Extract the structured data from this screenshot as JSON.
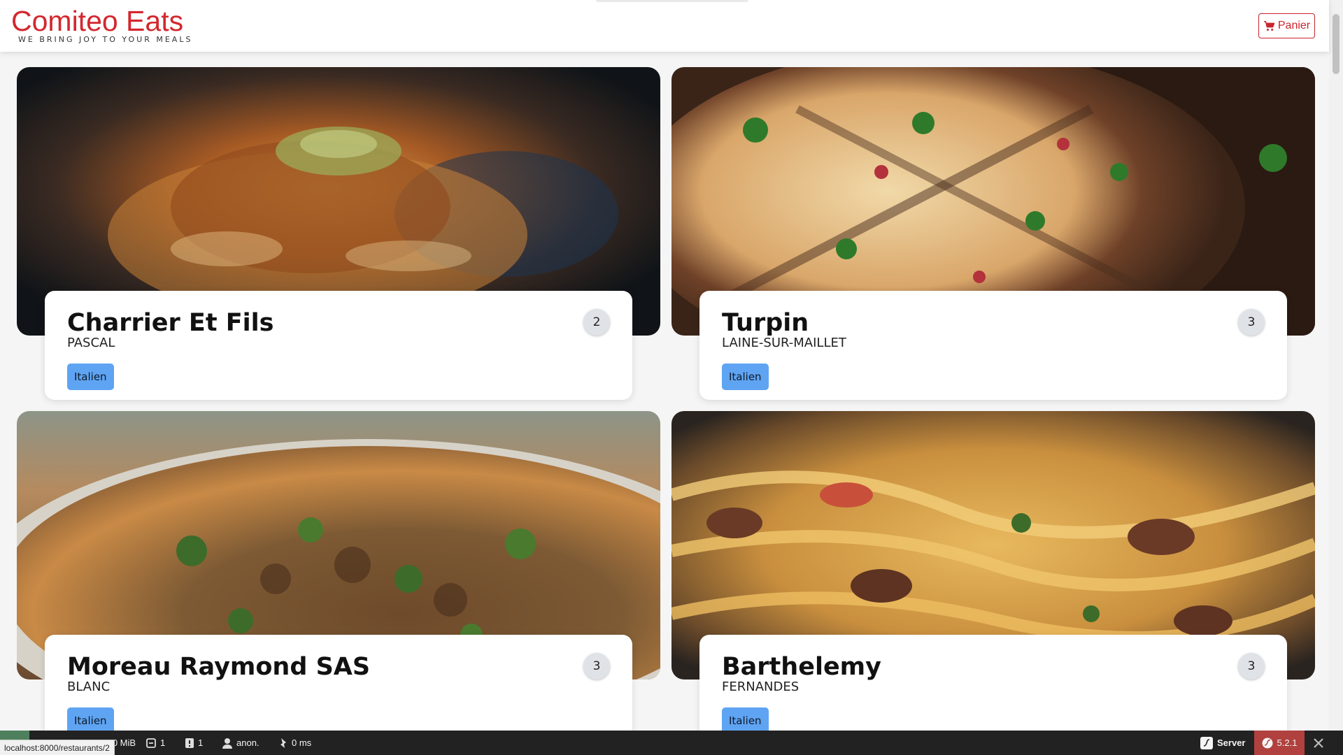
{
  "brand": {
    "title": "Comiteo Eats",
    "tagline": "WE BRING JOY TO YOUR MEALS",
    "color": "#d3272e"
  },
  "header": {
    "cart_label": "Panier",
    "cart_icon": "shopping-cart-icon"
  },
  "restaurants": [
    {
      "name": "Charrier Et Fils",
      "city": "PASCAL",
      "category": "Italien",
      "count": "2",
      "image": "pasta-bolognese-photo"
    },
    {
      "name": "Turpin",
      "city": "LAINE-SUR-MAILLET",
      "category": "Italien",
      "count": "3",
      "image": "pizza-on-board-photo"
    },
    {
      "name": "Moreau Raymond SAS",
      "city": "BLANC",
      "category": "Italien",
      "count": "3",
      "image": "mushroom-pizza-photo"
    },
    {
      "name": "Barthelemy",
      "city": "FERNANDES",
      "category": "Italien",
      "count": "3",
      "image": "fettuccine-beef-photo"
    }
  ],
  "toolbar": {
    "memory": "2.0 MiB",
    "forms": "1",
    "validator": "1",
    "user": "anon.",
    "time": "0 ms",
    "server_label": "Server",
    "version": "5.2.1"
  },
  "status_url": "localhost:8000/restaurants/2",
  "accent_colors": {
    "tag": "#5fa4f2",
    "cart": "#c9252c",
    "toolbar": "#222222",
    "version_bg": "#b0413e"
  }
}
